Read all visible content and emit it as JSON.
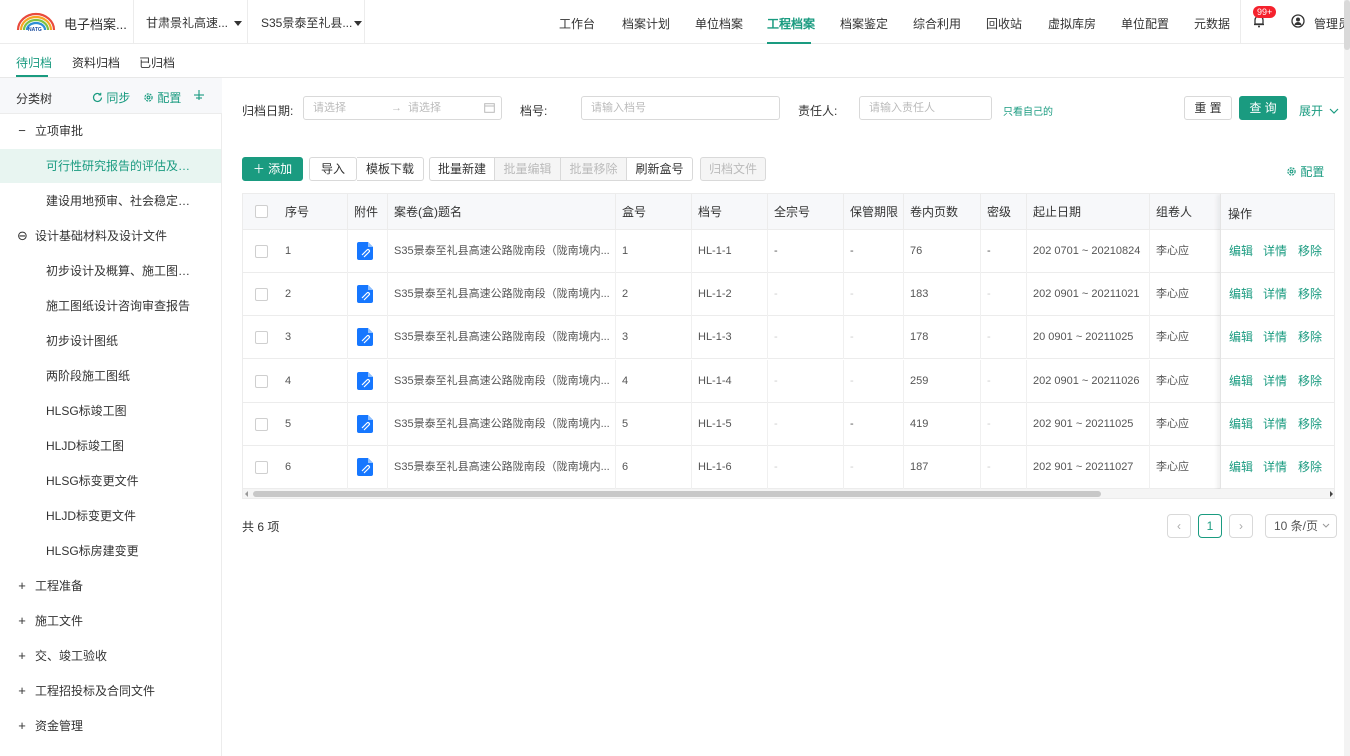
{
  "header": {
    "system_title": "电子档案...",
    "project_select_1": "甘肃景礼高速...",
    "project_select_2": "S35景泰至礼县...",
    "nav": [
      "工作台",
      "档案计划",
      "单位档案",
      "工程档案",
      "档案鉴定",
      "综合利用",
      "回收站",
      "虚拟库房",
      "单位配置",
      "元数据"
    ],
    "active_nav": "工程档案",
    "badge": "99+",
    "user": "管理员",
    "accent_color": "#1a9b80"
  },
  "subtabs": [
    "待归档",
    "资料归档",
    "已归档"
  ],
  "sidebar": {
    "title": "分类树",
    "sync": "同步",
    "config": "配置",
    "items": [
      {
        "toggle": "−",
        "label": "立项审批"
      },
      {
        "toggle": "",
        "label": "可行性研究报告的评估及行工..."
      },
      {
        "toggle": "",
        "label": "建设用地预审、社会稳定风险..."
      },
      {
        "toggle": "⊖",
        "label": "设计基础材料及设计文件"
      },
      {
        "toggle": "",
        "label": "初步设计及概算、施工图及预..."
      },
      {
        "toggle": "",
        "label": "施工图纸设计咨询审查报告"
      },
      {
        "toggle": "",
        "label": "初步设计图纸"
      },
      {
        "toggle": "",
        "label": "两阶段施工图纸"
      },
      {
        "toggle": "",
        "label": "HLSG标竣工图"
      },
      {
        "toggle": "",
        "label": "HLJD标竣工图"
      },
      {
        "toggle": "",
        "label": "HLSG标变更文件"
      },
      {
        "toggle": "",
        "label": "HLJD标变更文件"
      },
      {
        "toggle": "",
        "label": "HLSG标房建变更"
      },
      {
        "toggle": "+",
        "label": "工程准备"
      },
      {
        "toggle": "+",
        "label": "施工文件"
      },
      {
        "toggle": "+",
        "label": "交、竣工验收"
      },
      {
        "toggle": "+",
        "label": "工程招投标及合同文件"
      },
      {
        "toggle": "+",
        "label": "资金管理"
      }
    ]
  },
  "filters": {
    "date_label": "归档日期:",
    "date_start_placeholder": "请选择",
    "date_arrow": "→",
    "date_end_placeholder": "请选择",
    "code_label": "档号:",
    "code_placeholder": "请输入档号",
    "owner_label": "责任人:",
    "owner_placeholder": "请输入责任人",
    "only_mine": "只看自己的",
    "reset": "重 置",
    "search": "查 询",
    "expand": "展开"
  },
  "toolbar": {
    "add": "添加",
    "import": "导入",
    "template_download": "模板下载",
    "batch_new": "批量新建",
    "batch_edit": "批量编辑",
    "batch_move": "批量移除",
    "refresh_box": "刷新盒号",
    "archive_file": "归档文件",
    "config": "配置"
  },
  "table": {
    "columns": [
      "序号",
      "附件",
      "案卷(盒)题名",
      "盒号",
      "档号",
      "全宗号",
      "保管期限",
      "卷内页数",
      "密级",
      "起止日期",
      "组卷人",
      "操作"
    ],
    "rows": [
      {
        "no": "1",
        "title": "S35景泰至礼县高速公路陇南段（陇南境内...",
        "box": "1",
        "code": "HL-1-1",
        "fonds": "-",
        "period": "-",
        "pages": "76",
        "secret": "-",
        "dates": "202  0701 ~ 20210824",
        "owner": "李心应"
      },
      {
        "no": "2",
        "title": "S35景泰至礼县高速公路陇南段（陇南境内...",
        "box": "2",
        "code": "HL-1-2",
        "fonds": "-",
        "period": "-",
        "pages": "183",
        "secret": "-",
        "dates": "202  0901 ~ 20211021",
        "owner": "李心应"
      },
      {
        "no": "3",
        "title": "S35景泰至礼县高速公路陇南段（陇南境内...",
        "box": "3",
        "code": "HL-1-3",
        "fonds": "-",
        "period": "-",
        "pages": "178",
        "secret": "-",
        "dates": "20  0901 ~ 20211025",
        "owner": "李心应"
      },
      {
        "no": "4",
        "title": "S35景泰至礼县高速公路陇南段（陇南境内...",
        "box": "4",
        "code": "HL-1-4",
        "fonds": "-",
        "period": "-",
        "pages": "259",
        "secret": "-",
        "dates": "202  0901 ~ 20211026",
        "owner": "李心应"
      },
      {
        "no": "5",
        "title": "S35景泰至礼县高速公路陇南段（陇南境内...",
        "box": "5",
        "code": "HL-1-5",
        "fonds": "-",
        "period": "-",
        "pages": "419",
        "secret": "-",
        "dates": "202  901 ~ 20211025",
        "owner": "李心应"
      },
      {
        "no": "6",
        "title": "S35景泰至礼县高速公路陇南段（陇南境内...",
        "box": "6",
        "code": "HL-1-6",
        "fonds": "-",
        "period": "-",
        "pages": "187",
        "secret": "-",
        "dates": "202  901 ~ 20211027",
        "owner": "李心应"
      }
    ],
    "ops": [
      "编辑",
      "详情",
      "移除"
    ]
  },
  "pagination": {
    "total": "共 6 项",
    "current": "1",
    "page_size": "10 条/页"
  }
}
